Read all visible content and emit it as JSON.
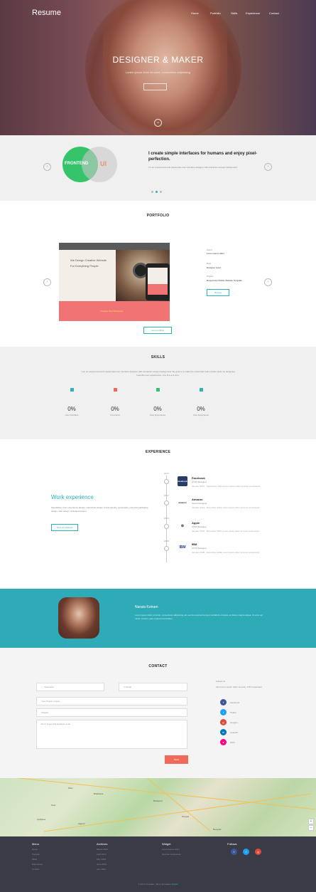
{
  "colors": {
    "accent": "#2ab3b8",
    "green": "#36c46a",
    "coral": "#f06a5a",
    "footer": "#3a3b47"
  },
  "header": {
    "brand": "Resume",
    "nav": [
      "Home",
      "Portfolio",
      "Skills",
      "Experience",
      "Contact"
    ]
  },
  "hero": {
    "title": "DESIGNER & MAKER",
    "subtitle": "Lorem ipsum dolor sit amet, consectetur adipisicing"
  },
  "about": {
    "circle_left": "FRONTEND",
    "circle_right": "UI",
    "title": "I create simple interfaces for humans and enjoy pixel-perfection.",
    "text": "I'm an experienced and passionate user interface designer with interaction design background."
  },
  "portfolio": {
    "title": "PORTFOLIO",
    "client_label": "Client",
    "client": "Lorem ipsum dolor",
    "role_label": "Role",
    "role": "Designer Lead",
    "project_label": "Project",
    "project": "Responsive Mobile Website Template",
    "mock_heading": "We Design Creative Website",
    "mock_sub": "For Everything People",
    "mock_footer": "Creative Tool Showcase",
    "browse_label": "Browse",
    "more_label": "more portfolio"
  },
  "skills": {
    "title": "SKILLS",
    "desc": "I am an experienced and passionate user interface designer with interaction design background. My goal is to make the world wide web a better place by designing beautiful user experiences, one line at a time.",
    "items": [
      {
        "value": "0%",
        "label": "User Interface",
        "color": "#2ab3b8"
      },
      {
        "value": "0%",
        "label": "Front End",
        "color": "#f06a5a"
      },
      {
        "value": "0%",
        "label": "User Experience",
        "color": "#36c46a"
      },
      {
        "value": "0%",
        "label": "User Experience",
        "color": "#2ab3b8"
      }
    ]
  },
  "experience": {
    "title": "EXPERIENCE",
    "heading": "Work experience",
    "text": "Specialties: User experience design, interaction design, brand identity, typography, print and packaging design, web design, animated banner.",
    "button": "View on LinkedIn",
    "jobs": [
      {
        "company": "Facebook",
        "role": "UI/UX Designer",
        "desc": "January 2013 - September 2014 Lorem ipsum dolor sit amet consectetur",
        "logo": "facebook",
        "date": "2013"
      },
      {
        "company": "Amazon",
        "role": "Senior Designer",
        "desc": "January 2012 - December 2012 Lorem ipsum dolor sit amet consectetur",
        "logo": "amazon",
        "date": "2012"
      },
      {
        "company": "Apple",
        "role": "UI/UX Designer",
        "desc": "January 2010 - December 2011 Lorem ipsum dolor sit amet consectetur",
        "logo": "",
        "date": "2010"
      },
      {
        "company": "IBM",
        "role": "UI/UX Designer",
        "desc": "January 2008 - December 2009 Lorem ipsum dolor sit amet consectetur",
        "logo": "IBM",
        "date": "2008"
      }
    ]
  },
  "profile": {
    "name": "Narata Kotram",
    "text": "Lorem ipsum dolor sit amet, consectetur adipisicing elit, sed do eiusmod tempor incididunt ut labore et dolore magna aliqua. Ut enim ad minim veniam, quis nostrud exercitation."
  },
  "contact": {
    "title": "CONTACT",
    "name_ph": "Username",
    "email_ph": "Email",
    "project_ph": "Your Project project",
    "subject_ph": "Subject",
    "message_ph": "Don't forget that kindness is all",
    "send": "Send",
    "follow_label": "Follow Us",
    "follow_text": "123 Lorem ipsum dolor sit amet, 478 consectetur",
    "socials": [
      {
        "name": "Facebook",
        "color": "#3b5998",
        "glyph": "f"
      },
      {
        "name": "Twitter",
        "color": "#1da1f2",
        "glyph": "t"
      },
      {
        "name": "Google+",
        "color": "#dd4b39",
        "glyph": "g"
      },
      {
        "name": "LinkedIn",
        "color": "#0077b5",
        "glyph": "in"
      },
      {
        "name": "Flickr",
        "color": "#ff0084",
        "glyph": "●"
      }
    ]
  },
  "map": {
    "cities": [
      "Wien",
      "Bratislava",
      "Budapest",
      "Zagreb",
      "Ljubljana",
      "Graz",
      "Szeged",
      "Beograd"
    ]
  },
  "footer": {
    "columns": [
      {
        "title": "Menu",
        "items": [
          "Home",
          "Portfolio",
          "Skills",
          "Experience",
          "Contact"
        ]
      },
      {
        "title": "Archives",
        "items": [
          "March 2014",
          "April 2014",
          "May 2014",
          "June 2014",
          "July 2014"
        ]
      },
      {
        "title": "Widget",
        "items": [
          "Lorem ipsum dolor",
          "Sit amet consectetur"
        ]
      },
      {
        "title": "Follows",
        "items": []
      }
    ],
    "copyright": "© 2014 Template - More Templates",
    "copyright_link": "Mobile"
  }
}
